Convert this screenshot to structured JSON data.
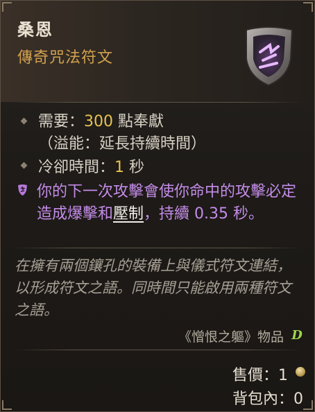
{
  "item": {
    "name": "桑恩",
    "type": "傳奇咒法符文"
  },
  "stats": {
    "requirement_label": "需要：",
    "requirement_value": "300",
    "requirement_unit": " 點奉獻",
    "overflow_text": "（溢能：延長持續時間）",
    "cooldown_label": "冷卻時間：",
    "cooldown_value": "1",
    "cooldown_unit": " 秒"
  },
  "effect": {
    "part1": "你的下一次攻擊會使你命中的攻擊必定造成爆擊和",
    "keyword": "壓制",
    "part2": "，持續 0.35 秒。"
  },
  "flavor_text": "在擁有兩個鑲孔的裝備上與儀式符文連結，以形成符文之語。同時間只能啟用兩種符文之語。",
  "origin": {
    "label": "《憎恨之軀》物品",
    "badge": "D"
  },
  "footer": {
    "sell_value": "售價：1",
    "inventory_count": "背包內：0"
  },
  "colors": {
    "rarity_orange": "#d3a24e",
    "effect_purple": "#c48ce8",
    "number_gold": "#e8c250",
    "badge_green": "#9ed54a"
  },
  "icons": {
    "rune": "rune-shield-icon",
    "effect": "purple-shield-effect-icon",
    "currency": "gold-coin-icon",
    "expansion": "vessel-of-hatred-icon"
  }
}
